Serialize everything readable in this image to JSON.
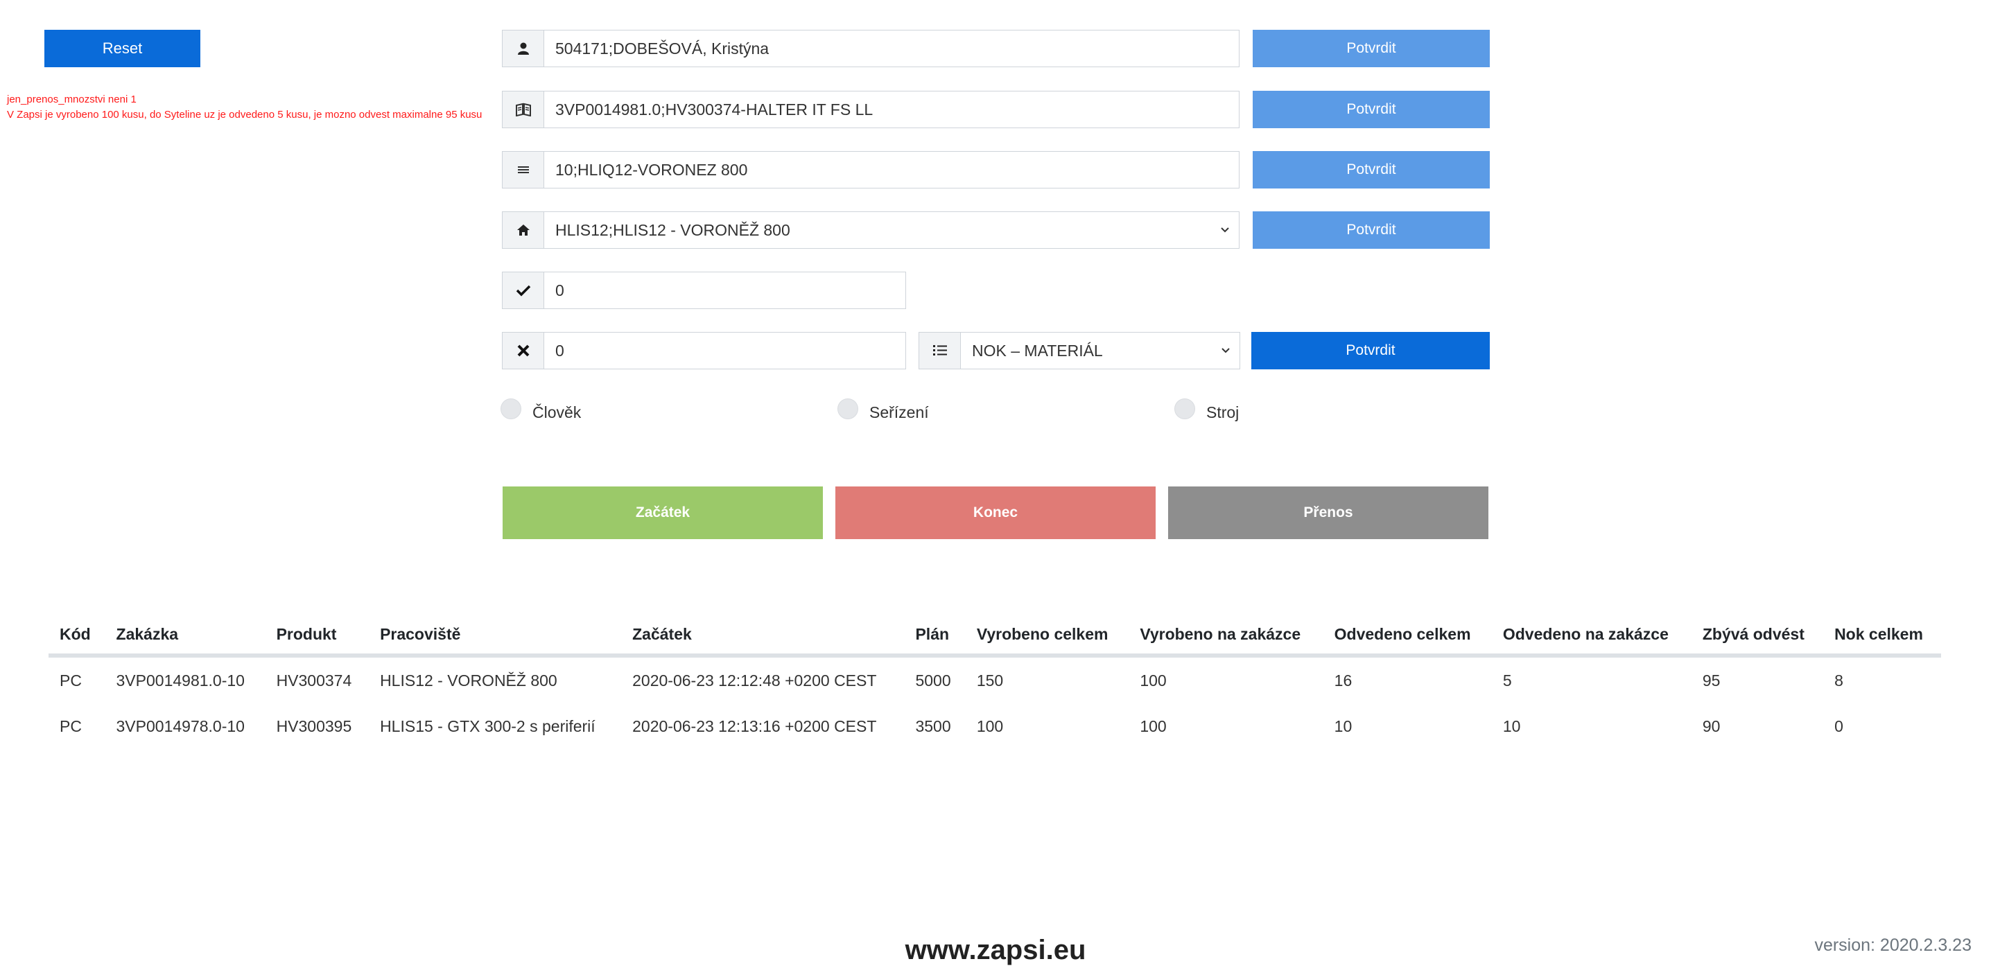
{
  "reset_label": "Reset",
  "messages": [
    "jen_prenos_mnozstvi neni 1",
    "V Zapsi je vyrobeno 100 kusu, do Syteline uz je odvedeno 5 kusu, je mozno odvest maximalne 95 kusu"
  ],
  "fields": {
    "user": {
      "icon": "user-icon",
      "value": "504171;DOBEŠOVÁ, Kristýna"
    },
    "order": {
      "icon": "book-icon",
      "value": "3VP0014981.0;HV300374-HALTER IT FS LL"
    },
    "operation": {
      "icon": "list-bars-icon",
      "value": "10;HLIQ12-VORONEZ 800"
    },
    "workplace": {
      "icon": "home-icon",
      "value": "HLIS12;HLIS12 - VORONĚŽ 800"
    },
    "ok_count": {
      "icon": "check-icon",
      "value": "0"
    },
    "nok_count": {
      "icon": "x-icon",
      "value": "0"
    },
    "nok_type": {
      "icon": "list-icon",
      "value": "NOK – MATERIÁL"
    }
  },
  "confirm_label": "Potvrdit",
  "radios": [
    "Člověk",
    "Seřízení",
    "Stroj"
  ],
  "actions": {
    "start": "Začátek",
    "end": "Konec",
    "transfer": "Přenos"
  },
  "table": {
    "headers": [
      "Kód",
      "Zakázka",
      "Produkt",
      "Pracoviště",
      "Začátek",
      "Plán",
      "Vyrobeno celkem",
      "Vyrobeno na zakázce",
      "Odvedeno celkem",
      "Odvedeno na zakázce",
      "Zbývá odvést",
      "Nok celkem"
    ],
    "rows": [
      [
        "PC",
        "3VP0014981.0-10",
        "HV300374",
        "HLIS12 - VORONĚŽ 800",
        "2020-06-23 12:12:48 +0200 CEST",
        "5000",
        "150",
        "100",
        "16",
        "5",
        "95",
        "8"
      ],
      [
        "PC",
        "3VP0014978.0-10",
        "HV300395",
        "HLIS15 - GTX 300-2 s periferií",
        "2020-06-23 12:13:16 +0200 CEST",
        "3500",
        "100",
        "100",
        "10",
        "10",
        "90",
        "0"
      ]
    ]
  },
  "footer": {
    "url": "www.zapsi.eu",
    "version": "version: 2020.2.3.23"
  },
  "colors": {
    "primary": "#0a6bd9",
    "primary_light": "#5b9be6",
    "start": "#9bc969",
    "end": "#e07b76",
    "transfer": "#8e8e8e",
    "error": "#ff1a1a"
  }
}
